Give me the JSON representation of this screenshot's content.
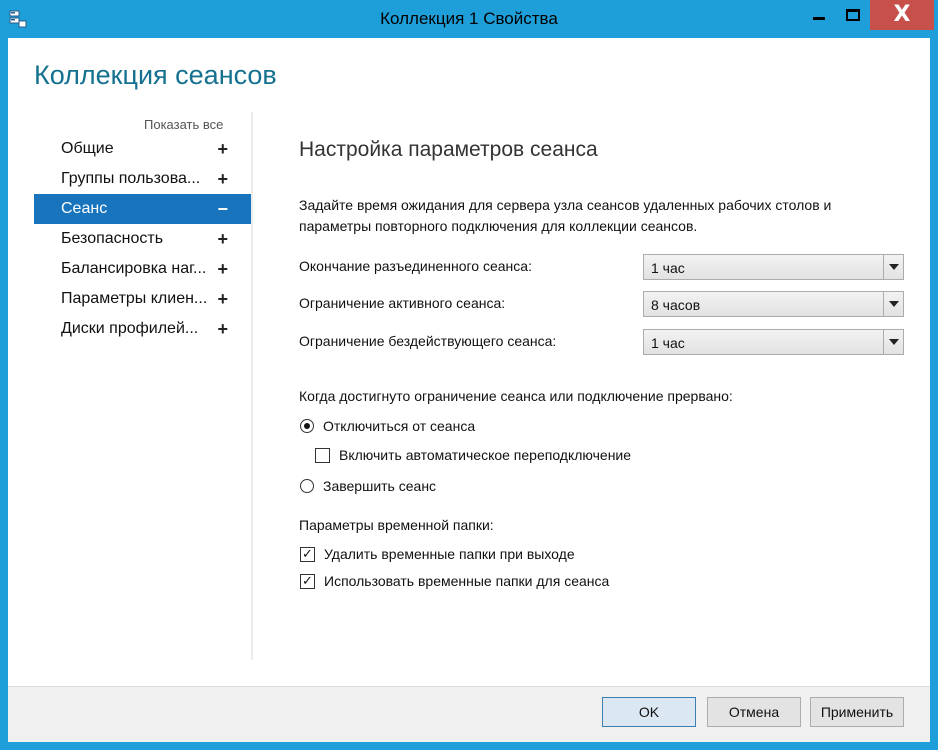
{
  "window": {
    "title": "Коллекция 1 Свойства",
    "close_glyph": "X",
    "accent_color": "#1e9fd9"
  },
  "heading": "Коллекция сеансов",
  "nav": {
    "show_all": "Показать все",
    "items": [
      {
        "label": "Общие",
        "sign": "+",
        "active": false
      },
      {
        "label": "Группы пользова...",
        "sign": "+",
        "active": false
      },
      {
        "label": "Сеанс",
        "sign": "−",
        "active": true
      },
      {
        "label": "Безопасность",
        "sign": "+",
        "active": false
      },
      {
        "label": "Балансировка наг...",
        "sign": "+",
        "active": false
      },
      {
        "label": "Параметры клиен...",
        "sign": "+",
        "active": false
      },
      {
        "label": "Диски профилей...",
        "sign": "+",
        "active": false
      }
    ],
    "active_color": "#1774bd"
  },
  "content": {
    "section_title": "Настройка параметров сеанса",
    "description": "Задайте время ожидания для сервера узла сеансов удаленных рабочих столов и параметры повторного подключения для коллекции сеансов.",
    "settings": [
      {
        "label": "Окончание разъединенного сеанса:",
        "value": "1 час"
      },
      {
        "label": "Ограничение активного сеанса:",
        "value": "8 часов"
      },
      {
        "label": "Ограничение бездействующего сеанса:",
        "value": "1 час"
      }
    ],
    "limit_question": "Когда достигнуто ограничение сеанса или подключение прервано:",
    "radio_disconnect": {
      "label": "Отключиться от сеанса",
      "selected": true
    },
    "auto_reconnect": {
      "label": "Включить автоматическое переподключение",
      "checked": false
    },
    "radio_end": {
      "label": "Завершить сеанс",
      "selected": false
    },
    "temp_label": "Параметры временной папки:",
    "temp_delete": {
      "label": "Удалить временные папки при выходе",
      "checked": true
    },
    "temp_use": {
      "label": "Использовать временные папки для сеанса",
      "checked": true
    }
  },
  "footer": {
    "ok": "OK",
    "cancel": "Отмена",
    "apply": "Применить"
  }
}
